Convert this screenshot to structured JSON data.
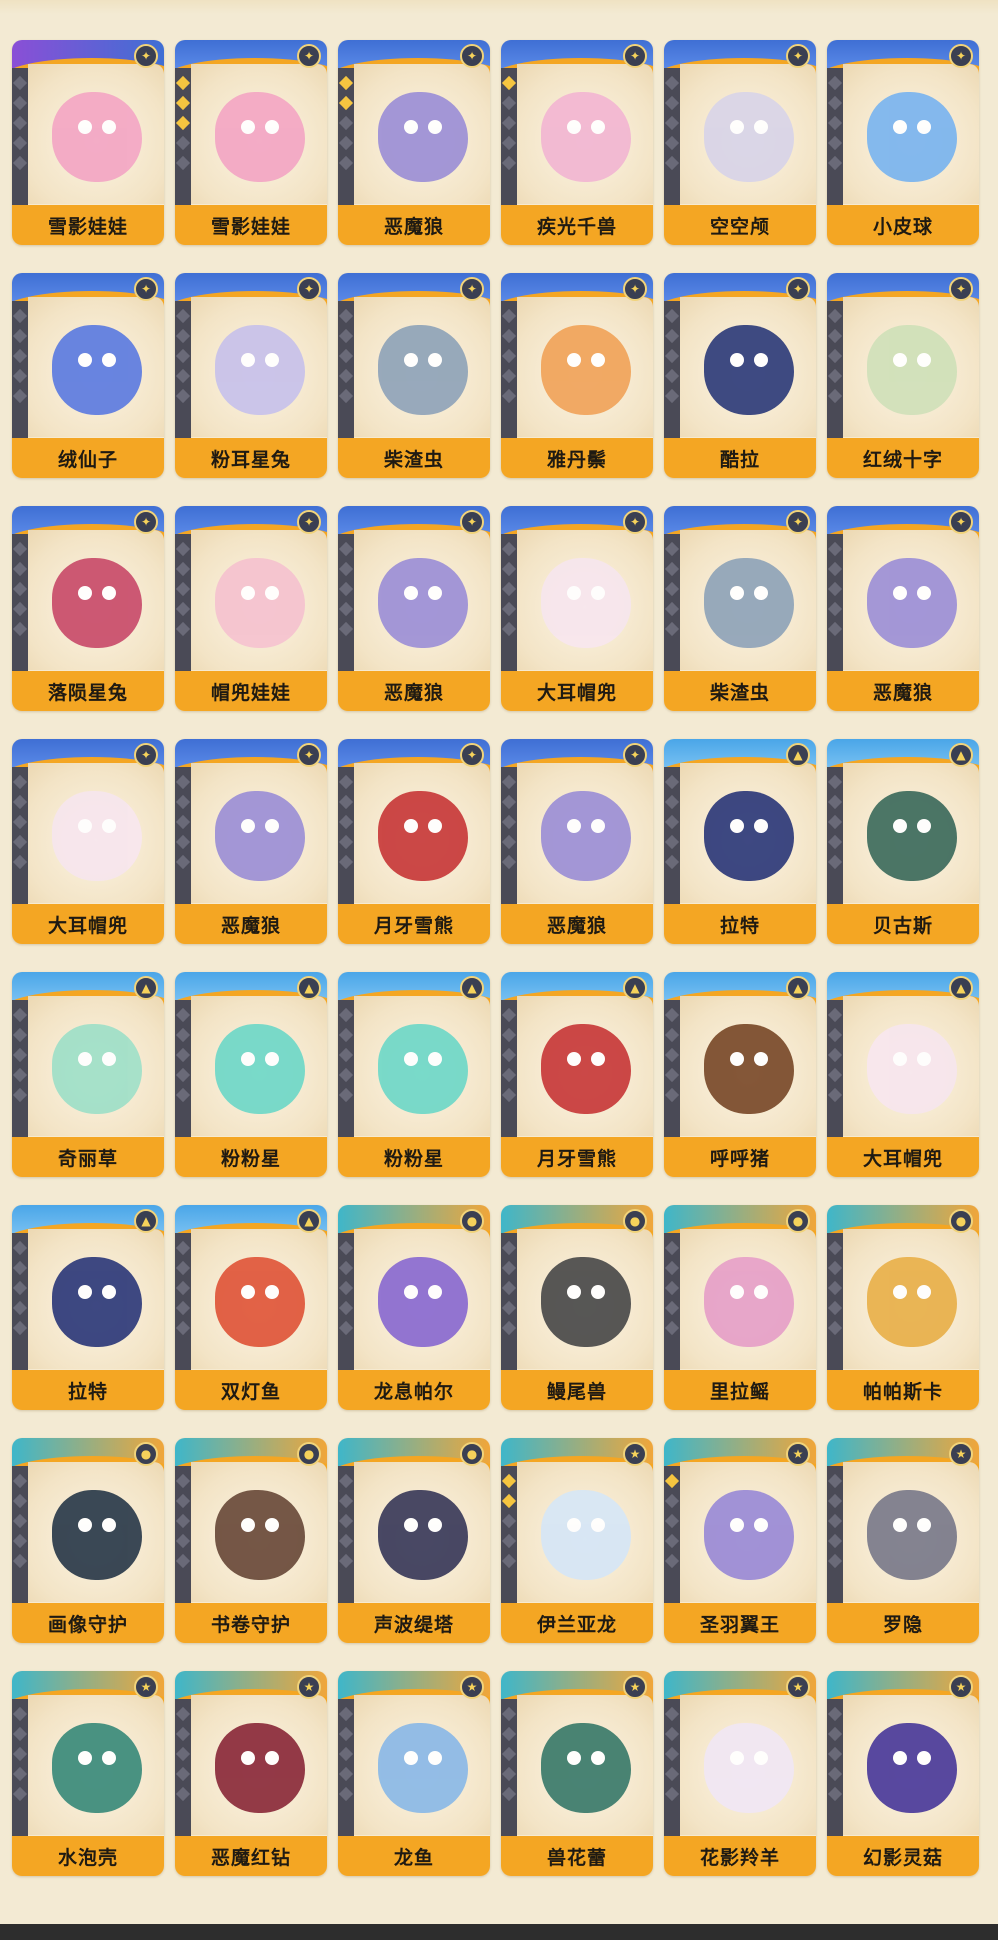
{
  "rarity_colors": {
    "blue": "#3f6fd4",
    "purple": "#8a4fd6",
    "sky": "#4aa6e8",
    "cyan": "#3fb6c9",
    "name_bar": "#f4a623"
  },
  "cards": [
    {
      "name": "雪影娃娃",
      "rarity": "purple",
      "badge_icon": "planet-icon",
      "stars": 0,
      "color": "#f3a6c4"
    },
    {
      "name": "雪影娃娃",
      "rarity": "blue",
      "badge_icon": "planet-icon",
      "stars": 3,
      "color": "#f3a6c4"
    },
    {
      "name": "恶魔狼",
      "rarity": "blue",
      "badge_icon": "planet-icon",
      "stars": 2,
      "color": "#9c8fd6"
    },
    {
      "name": "疾光千兽",
      "rarity": "blue",
      "badge_icon": "planet-icon",
      "stars": 1,
      "color": "#f2b6d2"
    },
    {
      "name": "空空颅",
      "rarity": "blue",
      "badge_icon": "planet-icon",
      "stars": 0,
      "color": "#d8d4e8"
    },
    {
      "name": "小皮球",
      "rarity": "blue",
      "badge_icon": "planet-icon",
      "stars": 0,
      "color": "#7ab4ef"
    },
    {
      "name": "绒仙子",
      "rarity": "blue",
      "badge_icon": "planet-icon",
      "stars": 0,
      "color": "#5c7be0"
    },
    {
      "name": "粉耳星兔",
      "rarity": "blue",
      "badge_icon": "planet-icon",
      "stars": 0,
      "color": "#c7c1ea"
    },
    {
      "name": "柴渣虫",
      "rarity": "blue",
      "badge_icon": "planet-icon",
      "stars": 0,
      "color": "#8fa3b8"
    },
    {
      "name": "雅丹鬃",
      "rarity": "blue",
      "badge_icon": "planet-icon",
      "stars": 0,
      "color": "#f0a35a"
    },
    {
      "name": "酷拉",
      "rarity": "blue",
      "badge_icon": "planet-icon",
      "stars": 0,
      "color": "#2e3c7a"
    },
    {
      "name": "红绒十字",
      "rarity": "blue",
      "badge_icon": "planet-icon",
      "stars": 0,
      "color": "#cfe0b8"
    },
    {
      "name": "落陨星兔",
      "rarity": "blue",
      "badge_icon": "planet-icon",
      "stars": 0,
      "color": "#c84b6a"
    },
    {
      "name": "帽兜娃娃",
      "rarity": "blue",
      "badge_icon": "planet-icon",
      "stars": 0,
      "color": "#f5c2cf"
    },
    {
      "name": "恶魔狼",
      "rarity": "blue",
      "badge_icon": "planet-icon",
      "stars": 0,
      "color": "#9c8fd6"
    },
    {
      "name": "大耳帽兜",
      "rarity": "blue",
      "badge_icon": "planet-icon",
      "stars": 0,
      "color": "#f7e6ee"
    },
    {
      "name": "柴渣虫",
      "rarity": "blue",
      "badge_icon": "planet-icon",
      "stars": 0,
      "color": "#8fa3b8"
    },
    {
      "name": "恶魔狼",
      "rarity": "blue",
      "badge_icon": "planet-icon",
      "stars": 0,
      "color": "#9c8fd6"
    },
    {
      "name": "大耳帽兜",
      "rarity": "blue",
      "badge_icon": "planet-icon",
      "stars": 0,
      "color": "#f7e6ee"
    },
    {
      "name": "恶魔狼",
      "rarity": "blue",
      "badge_icon": "planet-icon",
      "stars": 0,
      "color": "#9c8fd6"
    },
    {
      "name": "月牙雪熊",
      "rarity": "blue",
      "badge_icon": "planet-icon",
      "stars": 0,
      "color": "#c83a3a"
    },
    {
      "name": "恶魔狼",
      "rarity": "blue",
      "badge_icon": "planet-icon",
      "stars": 0,
      "color": "#9c8fd6"
    },
    {
      "name": "拉特",
      "rarity": "sky",
      "badge_icon": "hat-icon",
      "stars": 0,
      "color": "#2e3a7a"
    },
    {
      "name": "贝古斯",
      "rarity": "sky",
      "badge_icon": "hat-icon",
      "stars": 0,
      "color": "#3d6b5c"
    },
    {
      "name": "奇丽草",
      "rarity": "sky",
      "badge_icon": "hat-icon",
      "stars": 0,
      "color": "#9fe0c8"
    },
    {
      "name": "粉粉星",
      "rarity": "sky",
      "badge_icon": "hat-icon",
      "stars": 0,
      "color": "#6fd8c8"
    },
    {
      "name": "粉粉星",
      "rarity": "sky",
      "badge_icon": "hat-icon",
      "stars": 0,
      "color": "#6fd8c8"
    },
    {
      "name": "月牙雪熊",
      "rarity": "sky",
      "badge_icon": "hat-icon",
      "stars": 0,
      "color": "#c83a3a"
    },
    {
      "name": "呼呼猪",
      "rarity": "sky",
      "badge_icon": "hat-icon",
      "stars": 0,
      "color": "#7a4a2a"
    },
    {
      "name": "大耳帽兜",
      "rarity": "sky",
      "badge_icon": "hat-icon",
      "stars": 0,
      "color": "#f7e6ee"
    },
    {
      "name": "拉特",
      "rarity": "sky",
      "badge_icon": "hat-icon",
      "stars": 0,
      "color": "#2e3a7a"
    },
    {
      "name": "双灯鱼",
      "rarity": "sky",
      "badge_icon": "hat-icon",
      "stars": 0,
      "color": "#e0563a"
    },
    {
      "name": "龙息帕尔",
      "rarity": "cyan",
      "badge_icon": "moon-icon",
      "stars": 0,
      "color": "#8a6ad0"
    },
    {
      "name": "鳗尾兽",
      "rarity": "cyan",
      "badge_icon": "moon-icon",
      "stars": 0,
      "color": "#4a4a4a"
    },
    {
      "name": "里拉鳐",
      "rarity": "cyan",
      "badge_icon": "moon-icon",
      "stars": 0,
      "color": "#e6a0c8"
    },
    {
      "name": "帕帕斯卡",
      "rarity": "cyan",
      "badge_icon": "moon-icon",
      "stars": 0,
      "color": "#e8b04a"
    },
    {
      "name": "画像守护",
      "rarity": "cyan",
      "badge_icon": "moon-icon",
      "stars": 0,
      "color": "#2a3a4a"
    },
    {
      "name": "书卷守护",
      "rarity": "cyan",
      "badge_icon": "moon-icon",
      "stars": 0,
      "color": "#6a4a3a"
    },
    {
      "name": "声波缇塔",
      "rarity": "cyan",
      "badge_icon": "moon-icon",
      "stars": 0,
      "color": "#3a3a5a"
    },
    {
      "name": "伊兰亚龙",
      "rarity": "cyan",
      "badge_icon": "star-icon",
      "stars": 2,
      "color": "#d6e6f6"
    },
    {
      "name": "圣羽翼王",
      "rarity": "cyan",
      "badge_icon": "star-icon",
      "stars": 1,
      "color": "#9a8ad6"
    },
    {
      "name": "罗隐",
      "rarity": "cyan",
      "badge_icon": "star-icon",
      "stars": 0,
      "color": "#7a7a8a"
    },
    {
      "name": "水泡壳",
      "rarity": "cyan",
      "badge_icon": "star-icon",
      "stars": 0,
      "color": "#3a8a7a"
    },
    {
      "name": "恶魔红钻",
      "rarity": "cyan",
      "badge_icon": "star-icon",
      "stars": 0,
      "color": "#8a2a3a"
    },
    {
      "name": "龙鱼",
      "rarity": "cyan",
      "badge_icon": "star-icon",
      "stars": 0,
      "color": "#8ab8e6"
    },
    {
      "name": "兽花蕾",
      "rarity": "cyan",
      "badge_icon": "star-icon",
      "stars": 0,
      "color": "#3a7a6a"
    },
    {
      "name": "花影羚羊",
      "rarity": "cyan",
      "badge_icon": "star-icon",
      "stars": 0,
      "color": "#f0e6f4"
    },
    {
      "name": "幻影灵菇",
      "rarity": "cyan",
      "badge_icon": "star-icon",
      "stars": 0,
      "color": "#4a3a9a"
    }
  ]
}
